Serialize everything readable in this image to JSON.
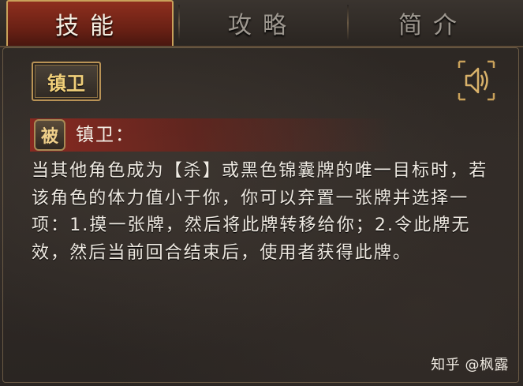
{
  "tabs": [
    {
      "label": "技能",
      "active": true
    },
    {
      "label": "攻略",
      "active": false
    },
    {
      "label": "简介",
      "active": false
    }
  ],
  "skill": {
    "title": "镇卫",
    "type_tag": "被",
    "header": "镇卫：",
    "description": "当其他角色成为【杀】或黑色锦囊牌的唯一目标时，若该角色的体力值小于你，你可以弃置一张牌并选择一项：1.摸一张牌，然后将此牌转移给你；2.令此牌无效，然后当前回合结束后，使用者获得此牌。"
  },
  "icons": {
    "sound": "speaker-icon"
  },
  "watermark": "知乎 @枫露",
  "colors": {
    "active_tab": "#7a2618",
    "gold": "#c9a15a",
    "text": "#efeae2"
  }
}
